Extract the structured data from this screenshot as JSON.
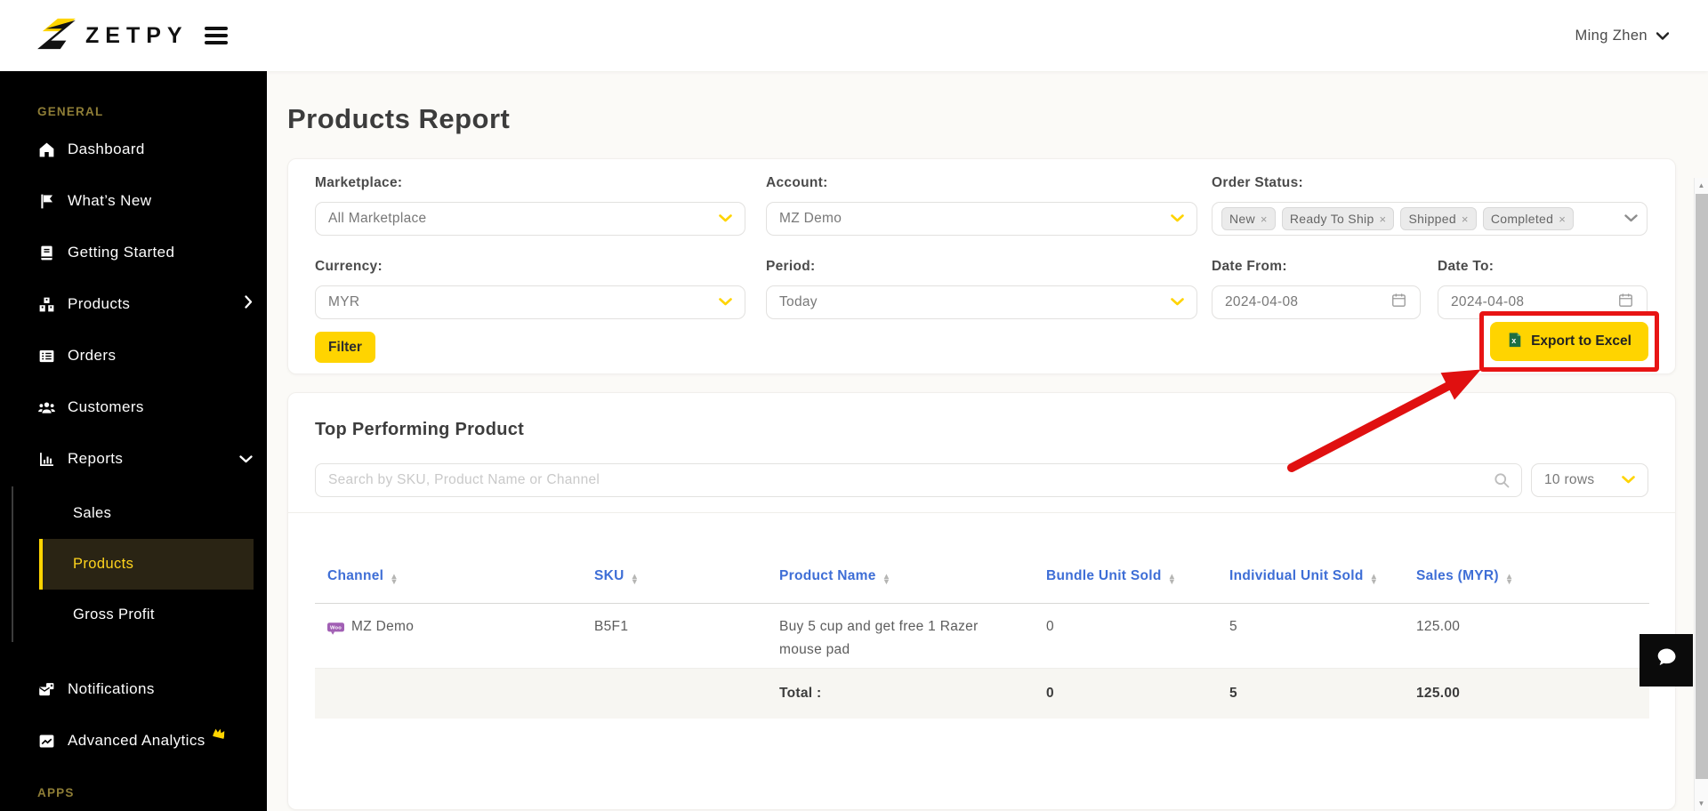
{
  "header": {
    "brand": "ZETPY",
    "user_name": "Ming Zhen"
  },
  "sidebar": {
    "section_general": "GENERAL",
    "section_apps": "APPS",
    "items": [
      {
        "label": "Dashboard",
        "icon": "home-icon"
      },
      {
        "label": "What’s New",
        "icon": "flag-icon"
      },
      {
        "label": "Getting Started",
        "icon": "book-icon"
      },
      {
        "label": "Products",
        "icon": "boxes-icon"
      },
      {
        "label": "Orders",
        "icon": "order-list-icon"
      },
      {
        "label": "Customers",
        "icon": "users-icon"
      },
      {
        "label": "Reports",
        "icon": "bar-chart-icon"
      },
      {
        "label": "Notifications",
        "icon": "mail-icon"
      },
      {
        "label": "Advanced Analytics",
        "icon": "line-chart-icon",
        "badge": "crown-icon"
      }
    ],
    "reports_submenu": [
      {
        "label": "Sales",
        "active": false
      },
      {
        "label": "Products",
        "active": true
      },
      {
        "label": "Gross Profit",
        "active": false
      }
    ]
  },
  "page": {
    "title": "Products Report"
  },
  "filters": {
    "marketplace": {
      "label": "Marketplace:",
      "value": "All Marketplace"
    },
    "account": {
      "label": "Account:",
      "value": "MZ Demo"
    },
    "order_status": {
      "label": "Order Status:",
      "tags": [
        "New",
        "Ready To Ship",
        "Shipped",
        "Completed"
      ],
      "remove": "×"
    },
    "currency": {
      "label": "Currency:",
      "value": "MYR"
    },
    "period": {
      "label": "Period:",
      "value": "Today"
    },
    "date_from": {
      "label": "Date From:",
      "value": "2024-04-08"
    },
    "date_to": {
      "label": "Date To:",
      "value": "2024-04-08"
    },
    "filter_button": "Filter",
    "export_button": "Export to Excel"
  },
  "table": {
    "title": "Top Performing Product",
    "search_placeholder": "Search by SKU, Product Name or Channel",
    "rows_selector": "10 rows",
    "columns": [
      "Channel",
      "SKU",
      "Product Name",
      "Bundle Unit Sold",
      "Individual Unit Sold",
      "Sales (MYR)"
    ],
    "rows": [
      {
        "channel": "MZ Demo",
        "channel_icon": "woocommerce-icon",
        "sku": "B5F1",
        "product_name": "Buy 5 cup and get free 1 Razer mouse pad",
        "bundle_unit_sold": "0",
        "individual_unit_sold": "5",
        "sales": "125.00"
      }
    ],
    "total": {
      "label": "Total :",
      "bundle_unit_sold": "0",
      "individual_unit_sold": "5",
      "sales": "125.00"
    }
  },
  "colors": {
    "accent": "#ffd400",
    "annotation_red": "#e81414",
    "table_header_blue": "#3e6ed6",
    "woocommerce_purple": "#7f54b3",
    "excel_green": "#1d6f42",
    "sidebar_bg": "#000000"
  }
}
